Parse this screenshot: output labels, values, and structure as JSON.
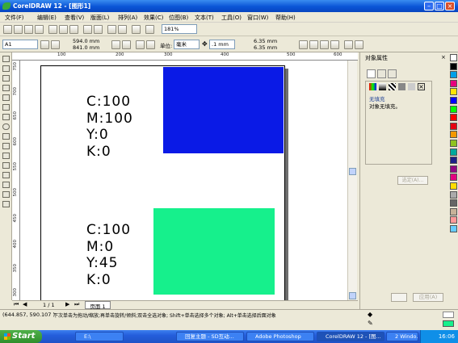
{
  "window": {
    "title": "CorelDRAW 12 - [图形1]"
  },
  "menu": [
    "文件(F)",
    "编辑(E)",
    "查看(V)",
    "版面(L)",
    "排列(A)",
    "效果(C)",
    "位图(B)",
    "文本(T)",
    "工具(O)",
    "窗口(W)",
    "帮助(H)"
  ],
  "toolbar": {
    "zoom": "181%"
  },
  "propbar": {
    "paper": "A1",
    "width": "594.0 mm",
    "height": "841.0 mm",
    "units_label": "单位:",
    "units": "毫米",
    "nudge": ".1 mm",
    "dup_x": "6.35 mm",
    "dup_y": "6.35 mm"
  },
  "ruler": {
    "top": [
      "100",
      "200",
      "300",
      "400",
      "500",
      "600"
    ],
    "left": [
      "750",
      "700",
      "650",
      "600",
      "550",
      "500",
      "450",
      "400",
      "350",
      "300"
    ]
  },
  "swatches": [
    {
      "lines": [
        "C:100",
        "M:100",
        "Y:0",
        "K:0"
      ],
      "color": "#0a1ae6"
    },
    {
      "lines": [
        "C:100",
        "M:0",
        "Y:45",
        "K:0"
      ],
      "color": "#16f08c"
    }
  ],
  "page_nav": {
    "count": "1 / 1",
    "tab": "页面 1"
  },
  "status": {
    "coords": "(644.857, 590.107 )",
    "hint": "下次单击为拖动/缩放;再单击旋转/倾斜;双击全选对象; Shift+单击选择多个对象; Alt+单击选择后面对象"
  },
  "docker": {
    "title": "对象属性",
    "fill_heading": "无填充",
    "fill_text": "对象无填充。",
    "apply_btn": "选定(A)...",
    "apply2": "应用(A)"
  },
  "palette": [
    "#ffffff",
    "#000000",
    "#00a0e8",
    "#e6007e",
    "#ffe600",
    "#0000ff",
    "#00ff00",
    "#ff0000",
    "#e60012",
    "#f39800",
    "#8fc31f",
    "#00a99d",
    "#1d2088",
    "#920783",
    "#e4007f",
    "#ffdd00",
    "#aaaaaa",
    "#666666",
    "#c7b299",
    "#ff9999",
    "#66ccff"
  ],
  "taskbar": {
    "start": "Start",
    "tasks": [
      "E:\\",
      "回复主题 - SD互动...",
      "Adobe Photoshop",
      "CorelDRAW 12 - [图...",
      "2 Windo..."
    ],
    "time": "16:06"
  }
}
